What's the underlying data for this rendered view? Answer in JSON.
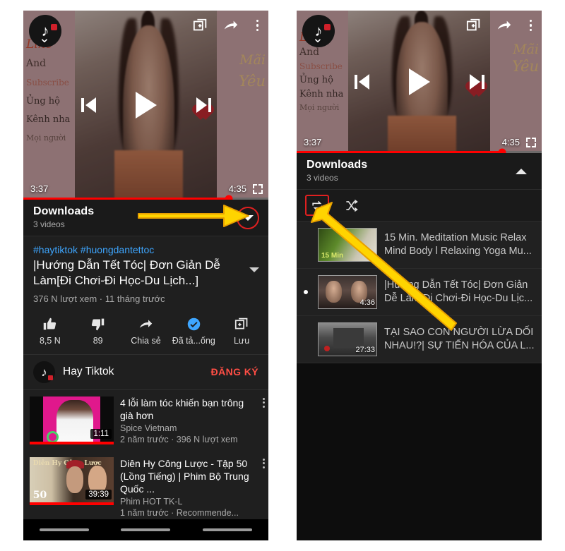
{
  "left_panel": {
    "player": {
      "channel_avatar": "tiktok-avatar",
      "collapse_icon": "chevron-down-icon",
      "add_to_queue_icon": "add-to-queue-icon",
      "share_icon": "share-icon",
      "more_icon": "kebab-menu-icon",
      "prev_icon": "previous-icon",
      "play_icon": "play-icon",
      "next_icon": "next-icon",
      "current_time": "3:37",
      "total_time": "4:35",
      "fullscreen_icon": "fullscreen-icon",
      "progress_percent": 84,
      "overlay_text": {
        "like": "Like",
        "and": "And",
        "subscribe": "Subscribe",
        "ung_ho": "Ủng hộ",
        "kenh_nha": "Kênh nha",
        "moi_nguoi": "Mọi người",
        "mai": "Mãi",
        "yeu": "Yêu"
      }
    },
    "downloads": {
      "title": "Downloads",
      "subtitle": "3 videos",
      "toggle_icon": "chevron-down-icon"
    },
    "meta": {
      "hashtags": "#haytiktok #huongdantettoc",
      "title": "|Hướng Dẫn Tết Tóc| Đơn Giản Dễ Làm[Đi Chơi-Đi Học-Du Lịch...]",
      "stats": "376 N lượt xem · 11 tháng trước",
      "expand_icon": "chevron-down-icon"
    },
    "actions": [
      {
        "icon": "thumbs-up-icon",
        "label": "8,5 N"
      },
      {
        "icon": "thumbs-down-icon",
        "label": "89"
      },
      {
        "icon": "share-icon",
        "label": "Chia sẻ"
      },
      {
        "icon": "downloaded-check-icon",
        "label": "Đã tả...ống"
      },
      {
        "icon": "save-icon",
        "label": "Lưu"
      }
    ],
    "channel": {
      "name": "Hay Tiktok",
      "subscribe_label": "ĐĂNG KÝ",
      "avatar": "tiktok-avatar"
    },
    "suggestions": [
      {
        "title": "4 lỗi làm tóc khiến bạn trông già hơn",
        "channel": "Spice Vietnam",
        "meta": "2 năm trước · 396 N lượt xem",
        "duration": "1:11"
      },
      {
        "title": "Diên Hy Công Lược - Tập 50 (Lồng Tiếng) | Phim Bộ Trung Quốc ...",
        "channel": "Phim HOT TK-L",
        "meta": "1 năm trước · Recommende...",
        "duration": "39:39",
        "thumb_label": "Diên Hy Công Lược",
        "thumb_number": "50"
      }
    ]
  },
  "right_panel": {
    "player": {
      "current_time": "3:37",
      "total_time": "4:35",
      "progress_percent": 84,
      "collapse_icon": "chevron-down-icon"
    },
    "downloads": {
      "title": "Downloads",
      "subtitle": "3 videos",
      "toggle_icon": "chevron-up-icon"
    },
    "modes": [
      {
        "icon": "loop-icon",
        "highlighted": true
      },
      {
        "icon": "shuffle-icon",
        "highlighted": false
      }
    ],
    "playlist": [
      {
        "title": "15 Min. Meditation Music Relax Mind Body l Relaxing Yoga Mu...",
        "duration": "15",
        "thumb_label": "15 Min",
        "playing": false
      },
      {
        "title": "|Hướng Dẫn Tết Tóc| Đơn Giản Dễ Làm[Đi Chơi-Đi Học-Du Lịc...",
        "duration": "4:36",
        "playing": true
      },
      {
        "title": "TẠI SAO CON NGƯỜI LỪA DỐI NHAU!?| SỰ TIẾN HÓA CỦA L...",
        "duration": "27:33",
        "playing": false
      }
    ]
  },
  "annotations": {
    "arrow_color": "#ffd400",
    "arrow_outline": "#e8a000",
    "highlight_color": "#e02020"
  }
}
